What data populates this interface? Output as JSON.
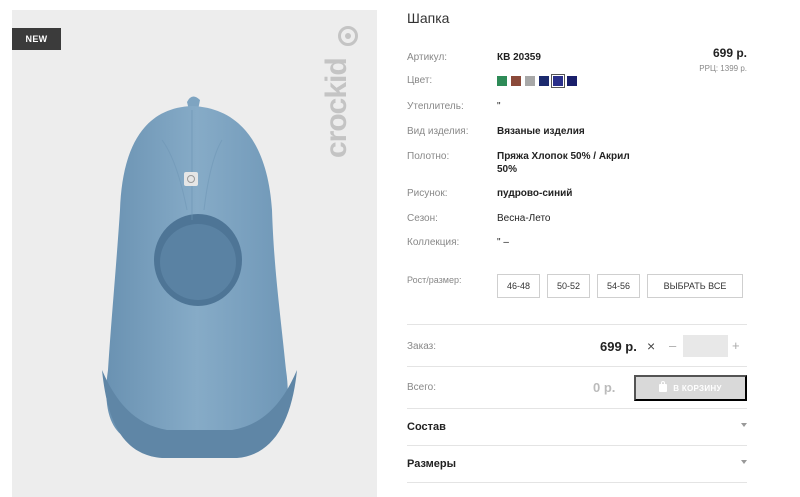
{
  "product": {
    "badge": "NEW",
    "brand": "crockid",
    "title": "Шапка",
    "price": "699 р.",
    "rrp": "РРЦ: 1399 р."
  },
  "details": {
    "article_label": "Артикул:",
    "article_value": "КВ 20359",
    "color_label": "Цвет:",
    "insulation_label": "Утеплитель:",
    "insulation_value": "\"",
    "type_label": "Вид изделия:",
    "type_value": "Вязаные изделия",
    "fabric_label": "Полотно:",
    "fabric_value": "Пряжа Хлопок 50% / Акрил 50%",
    "pattern_label": "Рисунок:",
    "pattern_value": "пудрово-синий",
    "season_label": "Сезон:",
    "season_value": "Весна-Лето",
    "collection_label": "Коллекция:",
    "collection_value": "\" –"
  },
  "colors": [
    "#2e8b57",
    "#8b4a3a",
    "#a8a8a8",
    "#1c2a6e",
    "#2a2f8a",
    "#1a1f6b"
  ],
  "sizes": {
    "label": "Рост/размер:",
    "options": [
      "46-48",
      "50-52",
      "54-56"
    ],
    "select_all": "ВЫБРАТЬ ВСЕ"
  },
  "order": {
    "label": "Заказ:",
    "price": "699 р.",
    "clear_icon": "×",
    "minus": "–",
    "plus": "+",
    "quantity": ""
  },
  "total": {
    "label": "Всего:",
    "value": "0 р.",
    "cart_button": "В КОРЗИНУ"
  },
  "accordion": {
    "composition": "Состав",
    "sizes": "Размеры"
  }
}
